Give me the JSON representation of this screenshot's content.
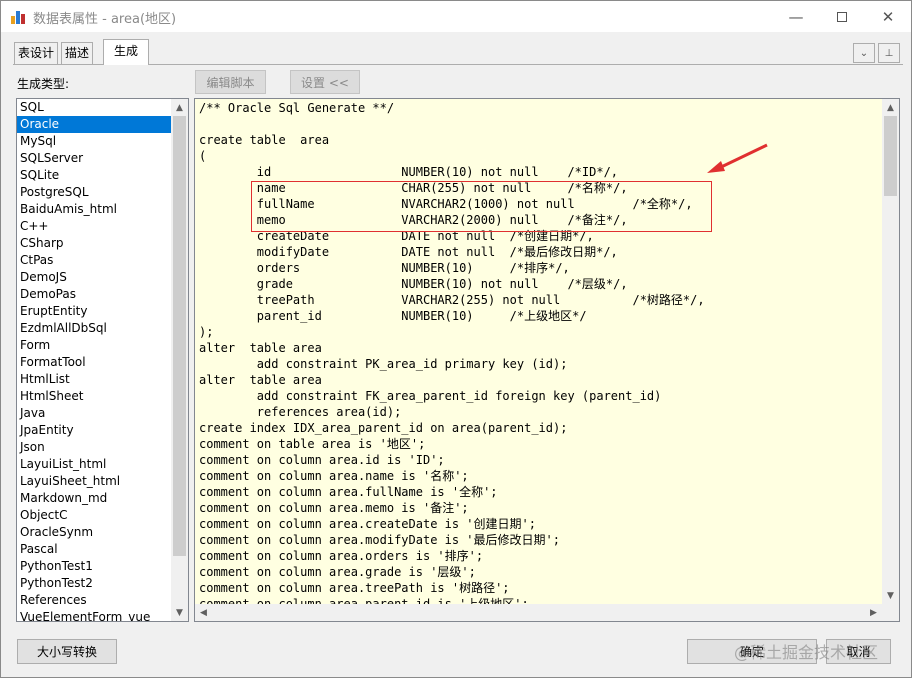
{
  "window": {
    "title": "数据表属性 - area(地区)",
    "icon_colors": [
      "#e8a020",
      "#2a7bd4",
      "#c03030"
    ]
  },
  "tabs": [
    {
      "label": "表设计",
      "active": false
    },
    {
      "label": "描述",
      "active": false
    },
    {
      "label": "生成",
      "active": true
    }
  ],
  "tab_nav": {
    "down_icon": "chevron-down-icon",
    "pin_icon": "pin-icon"
  },
  "generate": {
    "type_label": "生成类型:",
    "edit_script_label": "编辑脚本",
    "settings_label": "设置 <<"
  },
  "generator_list": {
    "selected": "Oracle",
    "items": [
      "SQL",
      "Oracle",
      "MySql",
      "SQLServer",
      "SQLite",
      "PostgreSQL",
      "BaiduAmis_html",
      "C++",
      "CSharp",
      "CtPas",
      "DemoJS",
      "DemoPas",
      "EruptEntity",
      "EzdmlAllDbSql",
      "Form",
      "FormatTool",
      "HtmlList",
      "HtmlSheet",
      "Java",
      "JpaEntity",
      "Json",
      "LayuiList_html",
      "LayuiSheet_html",
      "Markdown_md",
      "ObjectC",
      "OracleSynm",
      "Pascal",
      "PythonTest1",
      "PythonTest2",
      "References",
      "VueElementForm_vue"
    ]
  },
  "code_lines": [
    "/** Oracle Sql Generate **/",
    "",
    "create table  area",
    "(",
    "        id                  NUMBER(10) not null    /*ID*/,",
    "        name                CHAR(255) not null     /*名称*/,",
    "        fullName            NVARCHAR2(1000) not null        /*全称*/,",
    "        memo                VARCHAR2(2000) null    /*备注*/,",
    "        createDate          DATE not null  /*创建日期*/,",
    "        modifyDate          DATE not null  /*最后修改日期*/,",
    "        orders              NUMBER(10)     /*排序*/,",
    "        grade               NUMBER(10) not null    /*层级*/,",
    "        treePath            VARCHAR2(255) not null          /*树路径*/,",
    "        parent_id           NUMBER(10)     /*上级地区*/",
    ");",
    "alter  table area",
    "        add constraint PK_area_id primary key (id);",
    "alter  table area",
    "        add constraint FK_area_parent_id foreign key (parent_id)",
    "        references area(id);",
    "create index IDX_area_parent_id on area(parent_id);",
    "comment on table area is '地区';",
    "comment on column area.id is 'ID';",
    "comment on column area.name is '名称';",
    "comment on column area.fullName is '全称';",
    "comment on column area.memo is '备注';",
    "comment on column area.createDate is '创建日期';",
    "comment on column area.modifyDate is '最后修改日期';",
    "comment on column area.orders is '排序';",
    "comment on column area.grade is '层级';",
    "comment on column area.treePath is '树路径';",
    "comment on column area.parent_id is '上级地区';"
  ],
  "buttons": {
    "case_convert": "大小写转换",
    "ok": "确定",
    "cancel": "取消"
  },
  "annotation_color": "#e03030",
  "watermark": "@稀土掘金技术社区"
}
